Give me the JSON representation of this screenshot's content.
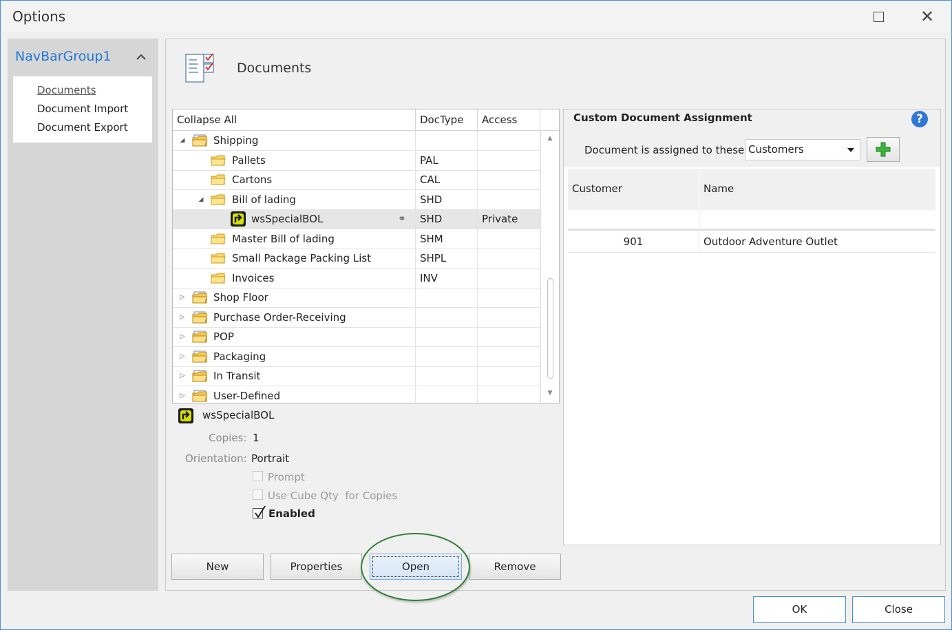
{
  "window": {
    "title": "Options"
  },
  "nav": {
    "group_label": "NavBarGroup1",
    "items": [
      {
        "label": "Documents",
        "selected": true
      },
      {
        "label": "Document Import",
        "selected": false
      },
      {
        "label": "Document Export",
        "selected": false
      }
    ]
  },
  "page": {
    "title": "Documents"
  },
  "tree": {
    "columns": [
      "Collapse All",
      "DocType",
      "Access"
    ],
    "rows": [
      {
        "label": "Shipping",
        "doctype": "",
        "access": "",
        "level": 0,
        "icon": "folder-stack-icon",
        "expanded": true
      },
      {
        "label": "Pallets",
        "doctype": "PAL",
        "access": "",
        "level": 1,
        "icon": "folder-icon"
      },
      {
        "label": "Cartons",
        "doctype": "CAL",
        "access": "",
        "level": 1,
        "icon": "folder-icon"
      },
      {
        "label": "Bill of lading",
        "doctype": "SHD",
        "access": "",
        "level": 1,
        "icon": "folder-icon",
        "expanded": true
      },
      {
        "label": "wsSpecialBOL",
        "doctype": "SHD",
        "access": "Private",
        "level": 2,
        "icon": "custom-doc-icon",
        "selected": true,
        "linked": true
      },
      {
        "label": "Master Bill of lading",
        "doctype": "SHM",
        "access": "",
        "level": 1,
        "icon": "folder-icon"
      },
      {
        "label": "Small Package Packing List",
        "doctype": "SHPL",
        "access": "",
        "level": 1,
        "icon": "folder-icon"
      },
      {
        "label": "Invoices",
        "doctype": "INV",
        "access": "",
        "level": 1,
        "icon": "folder-icon"
      },
      {
        "label": "Shop Floor",
        "doctype": "",
        "access": "",
        "level": 0,
        "icon": "folder-stack-icon",
        "expanded": false
      },
      {
        "label": "Purchase Order-Receiving",
        "doctype": "",
        "access": "",
        "level": 0,
        "icon": "folder-stack-icon",
        "expanded": false
      },
      {
        "label": "POP",
        "doctype": "",
        "access": "",
        "level": 0,
        "icon": "folder-stack-icon",
        "expanded": false
      },
      {
        "label": "Packaging",
        "doctype": "",
        "access": "",
        "level": 0,
        "icon": "folder-stack-icon",
        "expanded": false
      },
      {
        "label": "In Transit",
        "doctype": "",
        "access": "",
        "level": 0,
        "icon": "folder-stack-icon",
        "expanded": false
      },
      {
        "label": "User-Defined",
        "doctype": "",
        "access": "",
        "level": 0,
        "icon": "folder-stack-icon",
        "expanded": false
      }
    ]
  },
  "detail": {
    "name": "wsSpecialBOL",
    "copies_label": "Copies:",
    "copies_value": "1",
    "orientation_label": "Orientation:",
    "orientation_value": "Portrait",
    "checkboxes": [
      {
        "label": "Prompt",
        "checked": false
      },
      {
        "label": "Use Cube Qty  for Copies",
        "checked": false
      },
      {
        "label": "Enabled",
        "checked": true
      }
    ]
  },
  "actions": {
    "new": "New",
    "properties": "Properties",
    "open": "Open",
    "remove": "Remove"
  },
  "custom_assignment": {
    "title": "Custom Document Assignment",
    "help": "?",
    "assigned_label": "Document is assigned to these:",
    "assigned_value": "Customers",
    "columns": [
      "Customer",
      "Name"
    ],
    "rows": [
      {
        "customer": "901",
        "name": "Outdoor Adventure Outlet"
      }
    ]
  },
  "footer": {
    "ok": "OK",
    "close": "Close"
  },
  "colors": {
    "accent": "#1e78d6",
    "focus_border": "#4a8fd8",
    "highlight_ring": "#2e7d32"
  }
}
